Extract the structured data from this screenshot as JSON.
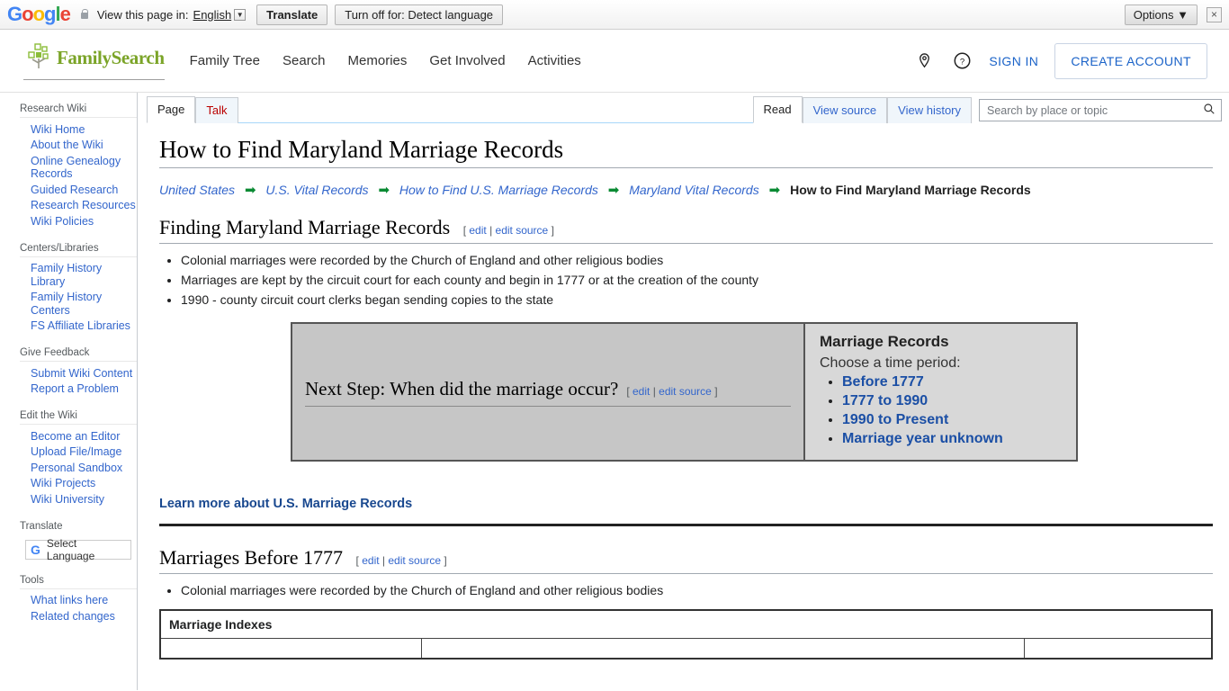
{
  "translate_bar": {
    "logo": "Google",
    "lock_icon": "lock-icon",
    "prompt": "View this page in:",
    "language": "English",
    "translate_button": "Translate",
    "turnoff_button": "Turn off for: Detect language",
    "options_button": "Options",
    "close_icon": "×"
  },
  "header": {
    "brand": "FamilySearch",
    "nav": [
      {
        "label": "Family Tree"
      },
      {
        "label": "Search"
      },
      {
        "label": "Memories"
      },
      {
        "label": "Get Involved"
      },
      {
        "label": "Activities"
      }
    ],
    "location_icon": "location-pin-icon",
    "help_icon": "help-circle-icon",
    "sign_in": "SIGN IN",
    "create_account": "CREATE ACCOUNT"
  },
  "sidebar": {
    "groups": [
      {
        "heading": "Research Wiki",
        "items": [
          {
            "label": "Wiki Home"
          },
          {
            "label": "About the Wiki"
          },
          {
            "label": "Online Genealogy Records"
          },
          {
            "label": "Guided Research"
          },
          {
            "label": "Research Resources"
          },
          {
            "label": "Wiki Policies"
          }
        ]
      },
      {
        "heading": "Centers/Libraries",
        "items": [
          {
            "label": "Family History Library"
          },
          {
            "label": "Family History Centers"
          },
          {
            "label": "FS Affiliate Libraries"
          }
        ]
      },
      {
        "heading": "Give Feedback",
        "items": [
          {
            "label": "Submit Wiki Content"
          },
          {
            "label": "Report a Problem"
          }
        ]
      },
      {
        "heading": "Edit the Wiki",
        "items": [
          {
            "label": "Become an Editor"
          },
          {
            "label": "Upload File/Image"
          },
          {
            "label": "Personal Sandbox"
          },
          {
            "label": "Wiki Projects"
          },
          {
            "label": "Wiki University"
          }
        ]
      }
    ],
    "translate_heading": "Translate",
    "select_language": "Select Language",
    "tools_heading": "Tools",
    "tools_items": [
      {
        "label": "What links here"
      },
      {
        "label": "Related changes"
      }
    ]
  },
  "tabs": {
    "left": [
      {
        "label": "Page",
        "state": "active"
      },
      {
        "label": "Talk",
        "state": "new"
      }
    ],
    "right": [
      {
        "label": "Read",
        "state": "active"
      },
      {
        "label": "View source",
        "state": ""
      },
      {
        "label": "View history",
        "state": ""
      }
    ]
  },
  "search": {
    "placeholder": "Search by place or topic",
    "value": "",
    "icon": "search-icon"
  },
  "main": {
    "title": "How to Find Maryland Marriage Records",
    "breadcrumb": [
      {
        "label": "United States",
        "current": false
      },
      {
        "label": "U.S. Vital Records",
        "current": false
      },
      {
        "label": "How to Find U.S. Marriage Records",
        "current": false
      },
      {
        "label": "Maryland Vital Records",
        "current": false
      },
      {
        "label": "How to Find Maryland Marriage Records",
        "current": true
      }
    ],
    "breadcrumb_arrow": "➡",
    "section1": {
      "heading": "Finding Maryland Marriage Records",
      "edit": "edit",
      "edit_source": "edit source",
      "bullets": [
        "Colonial marriages were recorded by the Church of England and other religious bodies",
        "Marriages are kept by the circuit court for each county and begin in 1777 or at the creation of the county",
        "1990 - county circuit court clerks began sending copies to the state"
      ]
    },
    "next_step": {
      "heading": "Next Step: When did the marriage occur?",
      "edit": "edit",
      "edit_source": "edit source"
    },
    "marriage_records_panel": {
      "title": "Marriage Records",
      "subtitle": "Choose a time period:",
      "links": [
        {
          "label": "Before 1777"
        },
        {
          "label": "1777 to 1990"
        },
        {
          "label": "1990 to Present"
        },
        {
          "label": "Marriage year unknown"
        }
      ]
    },
    "learn_more": "Learn more about U.S. Marriage Records",
    "section2": {
      "heading": "Marriages Before 1777",
      "edit": "edit",
      "edit_source": "edit source",
      "bullets": [
        "Colonial marriages were recorded by the Church of England and other religious bodies"
      ],
      "table_caption": "Marriage Indexes"
    }
  },
  "colors": {
    "link": "#3366cc",
    "brand_green": "#7ba428",
    "accent_blue": "#1b63c8",
    "breadcrumb_arrow": "#0a8a33"
  }
}
